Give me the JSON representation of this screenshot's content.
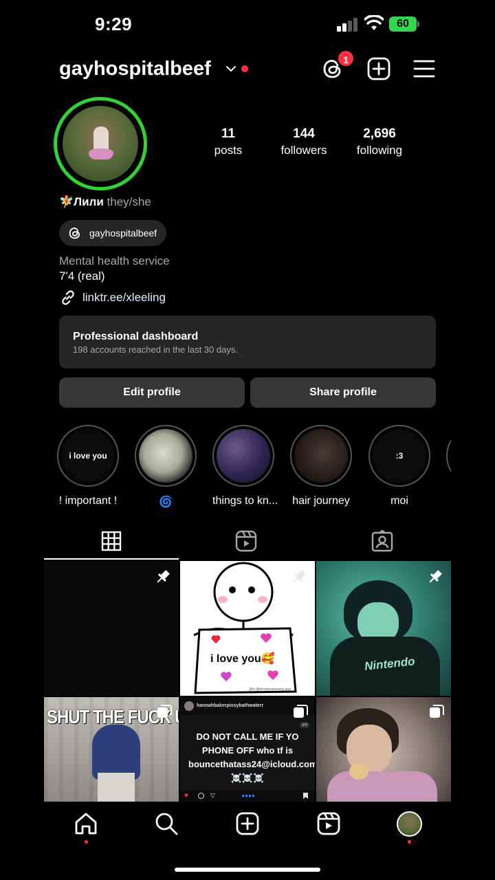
{
  "status_bar": {
    "time": "9:29",
    "battery": "60"
  },
  "header": {
    "username": "gayhospitalbeef",
    "threads_badge": "1"
  },
  "profile": {
    "stats": [
      {
        "num": "11",
        "label": "posts"
      },
      {
        "num": "144",
        "label": "followers"
      },
      {
        "num": "2,696",
        "label": "following"
      }
    ],
    "name_emoji": "🧚",
    "name": "Лили",
    "pronouns": "they/she",
    "threads_handle": "gayhospitalbeef",
    "category": "Mental health service",
    "bio": "7'4 (real)",
    "link": "linktr.ee/xleeling"
  },
  "dashboard": {
    "title": "Professional dashboard",
    "subtitle": "198 accounts reached in the last 30 days."
  },
  "buttons": {
    "edit": "Edit profile",
    "share": "Share profile"
  },
  "highlights": [
    {
      "label": "! important !",
      "cover_text": "i love you"
    },
    {
      "label": "🌀",
      "cover_text": ""
    },
    {
      "label": "things to kn...",
      "cover_text": ""
    },
    {
      "label": "hair journey",
      "cover_text": ""
    },
    {
      "label": "moi",
      "cover_text": ":3"
    }
  ],
  "posts": [
    {
      "pinned": true,
      "text": ""
    },
    {
      "pinned": true,
      "text": "i love you🥰",
      "small": "@tc:@wholesomeness.png"
    },
    {
      "pinned": true,
      "text": "Nintendo"
    },
    {
      "multi": true,
      "text": "SHUT THE FUCK UP"
    },
    {
      "multi": true,
      "handle": "hannahbakerpissybathwaterr",
      "text": "DO NOT CALL ME IF YO PHONE OFF who tf is bouncethatass24@icloud.com ☠️☠️☠️",
      "page": "3/5"
    },
    {
      "multi": true,
      "text": ""
    }
  ],
  "colors": {
    "story_ring": "#31d431",
    "notification": "#ff3040",
    "surface": "#262626"
  }
}
